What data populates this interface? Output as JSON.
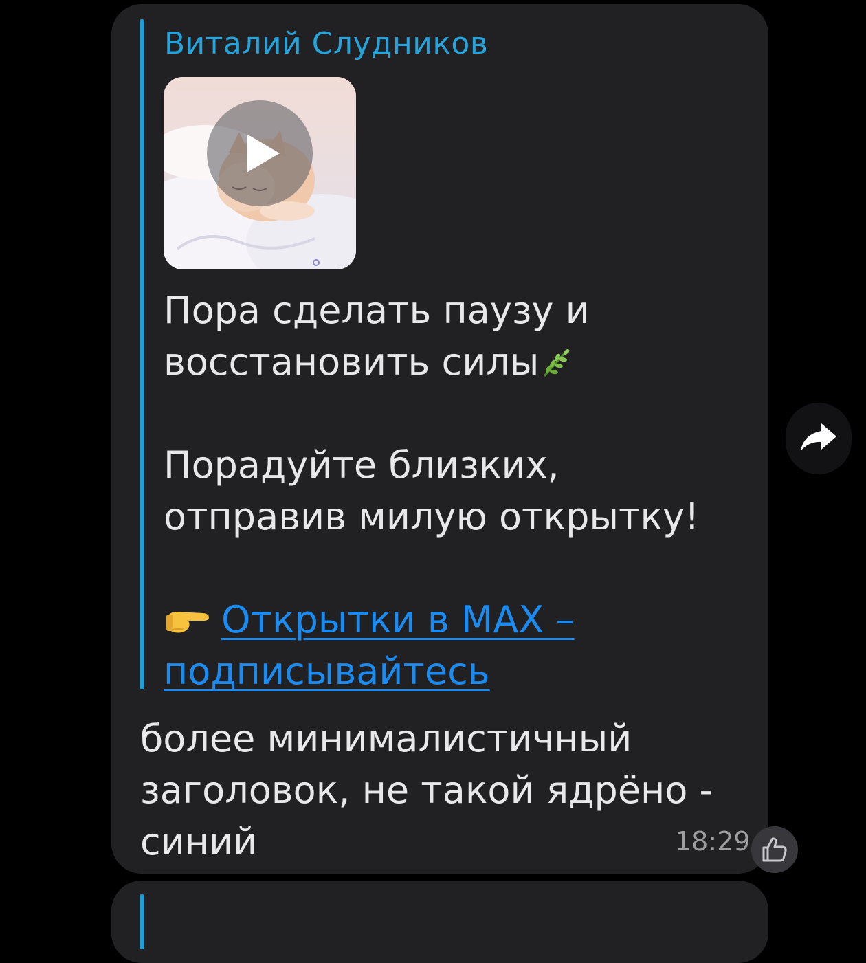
{
  "message": {
    "quoted_post": {
      "sender": "Виталий Слудников",
      "media": {
        "type": "video",
        "thumbnail": "sleeping-kitten",
        "play_icon": "play-icon"
      },
      "text_line_1": "Пора сделать паузу и",
      "text_line_2": "восстановить силы",
      "text_emoji_1": "herb-emoji",
      "text_line_3": "Порадуйте близких,",
      "text_line_4": "отправив милую открытку!",
      "link_emoji": "pointing-hand-emoji",
      "link_line_1": "Открытки в MAX –",
      "link_line_2": "подписывайтесь"
    },
    "reply": {
      "line_1": "более минималистичный",
      "line_2": "заголовок, не такой ядрёно -",
      "line_3": "синий"
    },
    "time": "18:29",
    "reaction_icon": "thumbs-up-icon",
    "forward_icon": "forward-arrow-icon"
  },
  "colors": {
    "background": "#000000",
    "bubble": "#212123",
    "sender_accent": "#25a3db",
    "quote_bar": "#1e9fd9",
    "link": "#1c8bf0",
    "text": "#e8e8ea",
    "time": "#9d9da2"
  }
}
